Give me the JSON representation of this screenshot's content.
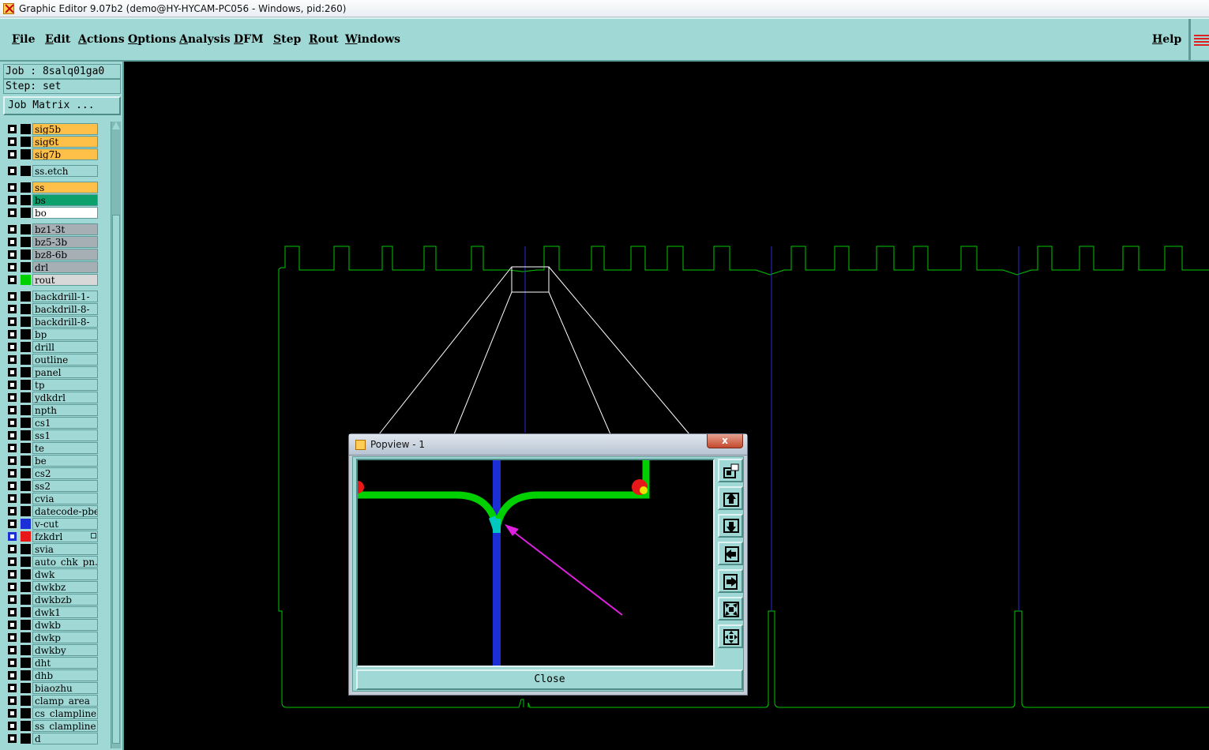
{
  "window": {
    "title": "Graphic Editor 9.07b2 (demo@HY-HYCAM-PC056 - Windows, pid:260)"
  },
  "menu": {
    "items": [
      "File",
      "Edit",
      "Actions",
      "Options",
      "Analysis",
      "DFM",
      "Step",
      "Rout",
      "Windows"
    ],
    "help": "Help"
  },
  "panel": {
    "job": "Job : 8salq01ga0",
    "step": "Step: set",
    "job_matrix": "Job Matrix ..."
  },
  "layers": [
    {
      "name": "sig5b",
      "color": "#ffc04a"
    },
    {
      "name": "sig6t",
      "color": "#ffc04a"
    },
    {
      "name": "sig7b",
      "color": "#ffc04a"
    },
    {
      "name": "ss.etch",
      "color": "#9fd8d4"
    },
    {
      "name": "ss",
      "color": "#ffc04a"
    },
    {
      "name": "bs",
      "color": "#0ba06c"
    },
    {
      "name": "bo",
      "color": "#ffffff"
    },
    {
      "name": "bz1-3t",
      "color": "#a6b0b4"
    },
    {
      "name": "bz5-3b",
      "color": "#a6b0b4"
    },
    {
      "name": "bz8-6b",
      "color": "#a6b0b4"
    },
    {
      "name": "drl",
      "color": "#a6b0b4"
    },
    {
      "name": "rout",
      "color": "#d8d8d8",
      "swatch": "#00d000"
    },
    {
      "name": "backdrill-1-",
      "color": "#9fd8d4"
    },
    {
      "name": "backdrill-8-",
      "color": "#9fd8d4"
    },
    {
      "name": "backdrill-8-",
      "color": "#9fd8d4"
    },
    {
      "name": "bp",
      "color": "#9fd8d4"
    },
    {
      "name": "drill",
      "color": "#9fd8d4"
    },
    {
      "name": "outline",
      "color": "#9fd8d4"
    },
    {
      "name": "panel",
      "color": "#9fd8d4"
    },
    {
      "name": "tp",
      "color": "#9fd8d4"
    },
    {
      "name": "ydkdrl",
      "color": "#9fd8d4"
    },
    {
      "name": "npth",
      "color": "#9fd8d4"
    },
    {
      "name": "cs1",
      "color": "#9fd8d4"
    },
    {
      "name": "ss1",
      "color": "#9fd8d4"
    },
    {
      "name": "te",
      "color": "#9fd8d4"
    },
    {
      "name": "be",
      "color": "#9fd8d4"
    },
    {
      "name": "cs2",
      "color": "#9fd8d4"
    },
    {
      "name": "ss2",
      "color": "#9fd8d4"
    },
    {
      "name": "cvia",
      "color": "#9fd8d4"
    },
    {
      "name": "datecode-pbe",
      "color": "#9fd8d4"
    },
    {
      "name": "v-cut",
      "color": "#9fd8d4",
      "swatch": "#1c2ed6"
    },
    {
      "name": "fzkdrl",
      "color": "#9fd8d4",
      "swatch": "#e81818",
      "selected": true
    },
    {
      "name": "svia",
      "color": "#9fd8d4"
    },
    {
      "name": "auto_chk_pn.",
      "color": "#9fd8d4"
    },
    {
      "name": "dwk",
      "color": "#9fd8d4"
    },
    {
      "name": "dwkbz",
      "color": "#9fd8d4"
    },
    {
      "name": "dwkbzb",
      "color": "#9fd8d4"
    },
    {
      "name": "dwk1",
      "color": "#9fd8d4"
    },
    {
      "name": "dwkb",
      "color": "#9fd8d4"
    },
    {
      "name": "dwkp",
      "color": "#9fd8d4"
    },
    {
      "name": "dwkby",
      "color": "#9fd8d4"
    },
    {
      "name": "dht",
      "color": "#9fd8d4"
    },
    {
      "name": "dhb",
      "color": "#9fd8d4"
    },
    {
      "name": "biaozhu",
      "color": "#9fd8d4"
    },
    {
      "name": "clamp_area",
      "color": "#9fd8d4"
    },
    {
      "name": "cs_clampline",
      "color": "#9fd8d4"
    },
    {
      "name": "ss_clampline",
      "color": "#9fd8d4"
    },
    {
      "name": "d",
      "color": "#9fd8d4"
    }
  ],
  "popview": {
    "title": "Popview - 1",
    "close_x": "x",
    "close": "Close",
    "tools": [
      "zoom-window-icon",
      "pan-up-icon",
      "pan-down-icon",
      "pan-left-icon",
      "pan-right-icon",
      "zoom-fit-icon",
      "zoom-home-icon"
    ]
  },
  "colors": {
    "panel_bg": "#9fd8d4",
    "rout": "#00d000",
    "vcut": "#1c2ed6",
    "fzkdrl": "#e81818",
    "arrow": "#e020e0"
  }
}
